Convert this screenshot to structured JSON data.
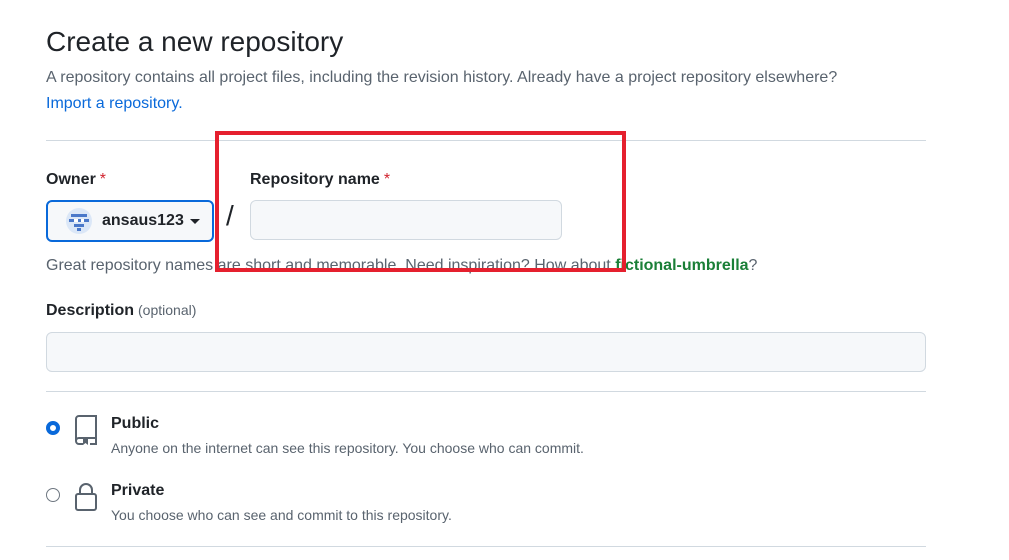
{
  "header": {
    "title": "Create a new repository",
    "subtitle": "A repository contains all project files, including the revision history. Already have a project repository elsewhere?",
    "import_link": "Import a repository."
  },
  "owner": {
    "label": "Owner",
    "required_mark": "*",
    "selected": "ansaus123",
    "avatar_icon": "identicon-avatar"
  },
  "separator": "/",
  "repo_name": {
    "label": "Repository name",
    "required_mark": "*",
    "value": "",
    "placeholder": ""
  },
  "hint": {
    "prefix": "Great repository names are short and memorable. Need inspiration? How about ",
    "suggestion": "fictional-umbrella",
    "suffix": "?"
  },
  "description": {
    "label": "Description",
    "optional": "(optional)",
    "value": "",
    "placeholder": ""
  },
  "visibility": {
    "options": [
      {
        "title": "Public",
        "description": "Anyone on the internet can see this repository. You choose who can commit.",
        "icon": "repo-icon",
        "selected": true
      },
      {
        "title": "Private",
        "description": "You choose who can see and commit to this repository.",
        "icon": "lock-icon",
        "selected": false
      }
    ]
  },
  "colors": {
    "accent": "#0969da",
    "required": "#d1242f",
    "suggestion": "#1a7f37",
    "highlight": "#e5202e"
  }
}
